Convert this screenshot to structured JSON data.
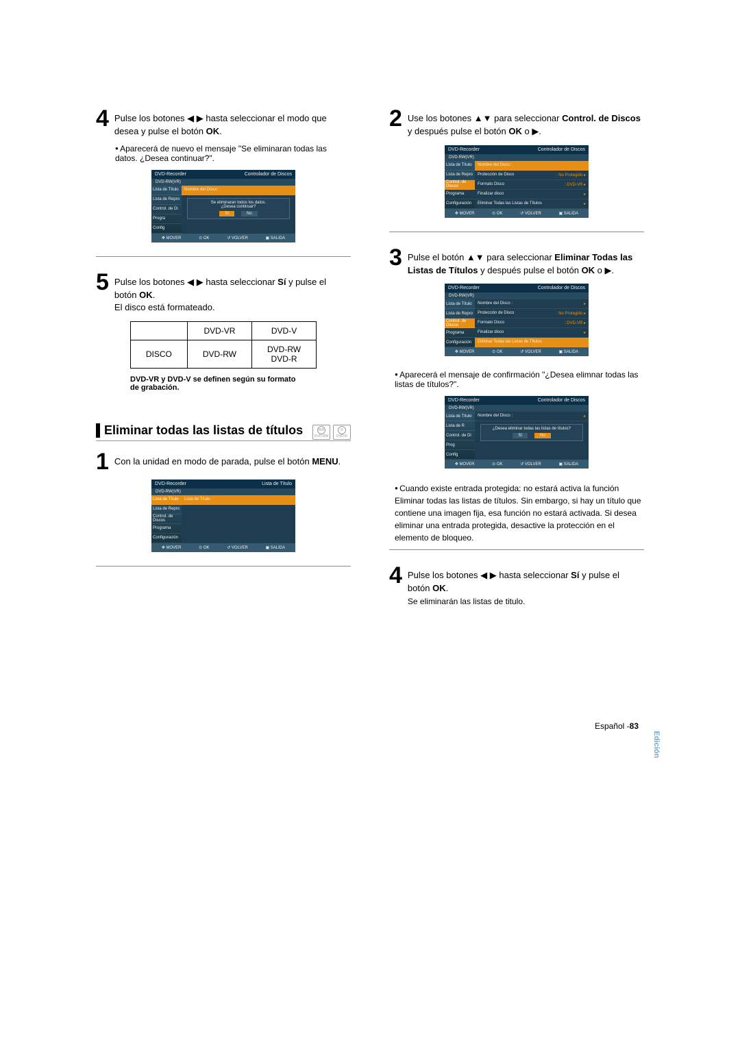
{
  "left": {
    "step4": {
      "text_a": "Pulse los botones ◀ ▶ hasta seleccionar el modo que desea y pulse el botón ",
      "ok": "OK",
      "period": ".",
      "bullet": "Aparecerá de nuevo el mensaje \"Se eliminaran todas las datos. ¿Desea continuar?\"."
    },
    "ui1": {
      "title": "DVD-Recorder",
      "header_r": "Controlador de Discos",
      "tab": "DVD-RW(VR)",
      "side": [
        "Lista de Título",
        "Lista de Repro",
        "Control. de Di",
        "Progra",
        "Config"
      ],
      "main_row": "Nombre del Disco :",
      "dialog_l1": "Se eliminaran todos los datos.",
      "dialog_l2": "¿Desea continuar?",
      "yes": "Sí",
      "no": "No",
      "foot": [
        "MOVER",
        "OK",
        "VOLVER",
        "SALIDA"
      ]
    },
    "step5": {
      "t1": "Pulse los botones ◀ ▶ hasta seleccionar ",
      "si": "Sí",
      "t2": " y pulse el botón ",
      "ok": "OK",
      "period": ".",
      "sub": "El disco está formateado."
    },
    "table": {
      "h1": "DVD-VR",
      "h2": "DVD-V",
      "r1": "DISCO",
      "r2a": "DVD-RW",
      "r2b_l1": "DVD-RW",
      "r2b_l2": "DVD-R"
    },
    "note": "DVD-VR y DVD-V se definen según su formato de grabación.",
    "section": "Eliminar todas las listas de títulos",
    "badges": [
      "DVD-RW",
      "DVD-R"
    ],
    "step1b": {
      "t1": "Con la unidad en modo de parada, pulse el botón ",
      "menu": "MENU",
      "period": "."
    },
    "ui2": {
      "title": "DVD-Recorder",
      "header_r": "Lista de Título",
      "tab": "DVD-RW(VR)",
      "side_hl": "Lista de Título",
      "side": [
        "Lista de Repro",
        "Control. de Discos",
        "Programa",
        "Configuración"
      ],
      "main_row": "Lista de Título",
      "foot": [
        "MOVER",
        "OK",
        "VOLVER",
        "SALIDA"
      ]
    }
  },
  "right": {
    "step2": {
      "t1": "Use los botones ▲▼ para seleccionar ",
      "b": "Control. de Discos",
      "t2": " y después pulse el botón ",
      "ok": "OK",
      "t3": " o ▶."
    },
    "ui1": {
      "title": "DVD-Recorder",
      "header_r": "Controlador de Discos",
      "tab": "DVD-RW(VR)",
      "side": [
        "Lista de Título",
        "Lista de Repro"
      ],
      "side_hl": "Control. de Discos",
      "side2": [
        "Programa",
        "Configuración"
      ],
      "rows": {
        "r1": "Nombre del Disco :",
        "r2a": "Protección de Disco",
        "r2b": ": No Protegido",
        "r3a": "Formato Disco",
        "r3b": ": DVD-VR",
        "r4": "Finalizar disco",
        "r5": "Eliminar Todas las Listas de Títulos"
      },
      "foot": [
        "MOVER",
        "OK",
        "VOLVER",
        "SALIDA"
      ]
    },
    "step3": {
      "t1": "Pulse el botón ▲▼ para seleccionar ",
      "b": "Eliminar Todas las Listas de Títulos",
      "t2": " y después pulse el botón ",
      "ok": "OK",
      "t3": " o ▶."
    },
    "ui2": {
      "title": "DVD-Recorder",
      "header_r": "Controlador de Discos",
      "tab": "DVD-RW(VR)",
      "side": [
        "Lista de Título",
        "Lista de Repro"
      ],
      "side_hl": "Control. de Discos",
      "side2": [
        "Programa",
        "Configuración"
      ],
      "rows": {
        "r1": "Nombre del Disco :",
        "r2a": "Protección de Disco",
        "r2b": ": No Protegido",
        "r3a": "Formato Disco",
        "r3b": ": DVD-VR",
        "r4": "Finalizar disco",
        "r5": "Eliminar Todas las Listas de Títulos"
      },
      "foot": [
        "MOVER",
        "OK",
        "VOLVER",
        "SALIDA"
      ]
    },
    "bullet1": "Aparecerá el mensaje de confirmación \"¿Desea elimnar todas las listas de títulos?\".",
    "ui3": {
      "title": "DVD-Recorder",
      "header_r": "Controlador de Discos",
      "tab": "DVD-RW(VR)",
      "side": [
        "Lista de Título",
        "Lista de R",
        "Control. de Di",
        "Prog",
        "Config"
      ],
      "main_row": "Nombre del Disco :",
      "dialog": "¿Desea eliminar todas las listas de títulos?",
      "yes": "Sí",
      "no": "No",
      "foot": [
        "MOVER",
        "OK",
        "VOLVER",
        "SALIDA"
      ]
    },
    "bullet2": "Cuando existe entrada protegida: no estará activa la función Eliminar todas las listas de títulos. Sin embargo, si hay un título que contiene una imagen fija, esa función no estará activada. Si desea eliminar una entrada protegida, desactive la protección en el elemento de bloqueo.",
    "step4": {
      "t1": "Pulse los botones ◀ ▶  hasta seleccionar ",
      "si": "Sí",
      "t2": " y pulse el botón ",
      "ok": "OK",
      "period": ".",
      "sub": "Se eliminarán las listas de titulo."
    }
  },
  "footer": {
    "lang": "Español -",
    "page": "83",
    "side": "Edición"
  }
}
